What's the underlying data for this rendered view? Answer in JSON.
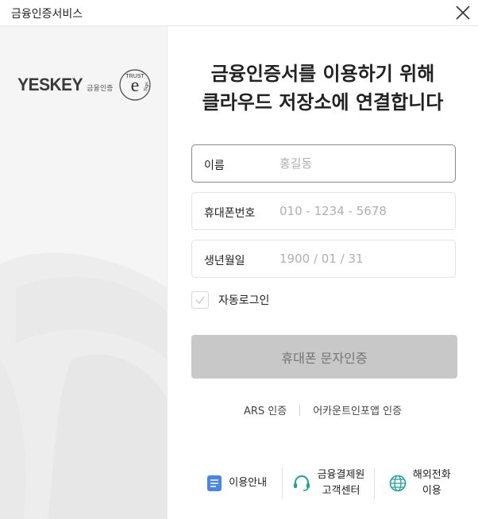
{
  "window": {
    "title": "금융인증서비스"
  },
  "brand": {
    "logo": "YESKEY",
    "sub": "금융인증",
    "seal_top": "TRUST",
    "seal_right": "Sign",
    "seal_letter": "e"
  },
  "heading": {
    "line1": "금융인증서를 이용하기 위해",
    "line2": "클라우드 저장소에 연결합니다"
  },
  "form": {
    "name": {
      "label": "이름",
      "placeholder": "홍길동",
      "value": ""
    },
    "phone": {
      "label": "휴대폰번호",
      "placeholder": "010 - 1234 - 5678",
      "value": ""
    },
    "birth": {
      "label": "생년월일",
      "placeholder": "1900 / 01 / 31",
      "value": ""
    },
    "auto_login": {
      "label": "자동로그인",
      "checked": false
    }
  },
  "submit": {
    "label": "휴대폰 문자인증",
    "enabled": false
  },
  "alt_links": {
    "ars": "ARS 인증",
    "kakao": "어카운트인포앱 인증"
  },
  "bottom_links": {
    "guide": "이용안내",
    "center_line1": "금융결제원",
    "center_line2": "고객센터",
    "overseas_line1": "해외전화",
    "overseas_line2": "이용"
  },
  "icons": {
    "close": "close-icon",
    "check": "check-icon",
    "guide": "document-icon",
    "center": "headset-icon",
    "overseas": "globe-icon"
  },
  "colors": {
    "accent_blue": "#4a86e8",
    "teal": "#1fa39b",
    "button_disabled": "#c8c8c8",
    "left_panel": "#f5f5f5"
  }
}
